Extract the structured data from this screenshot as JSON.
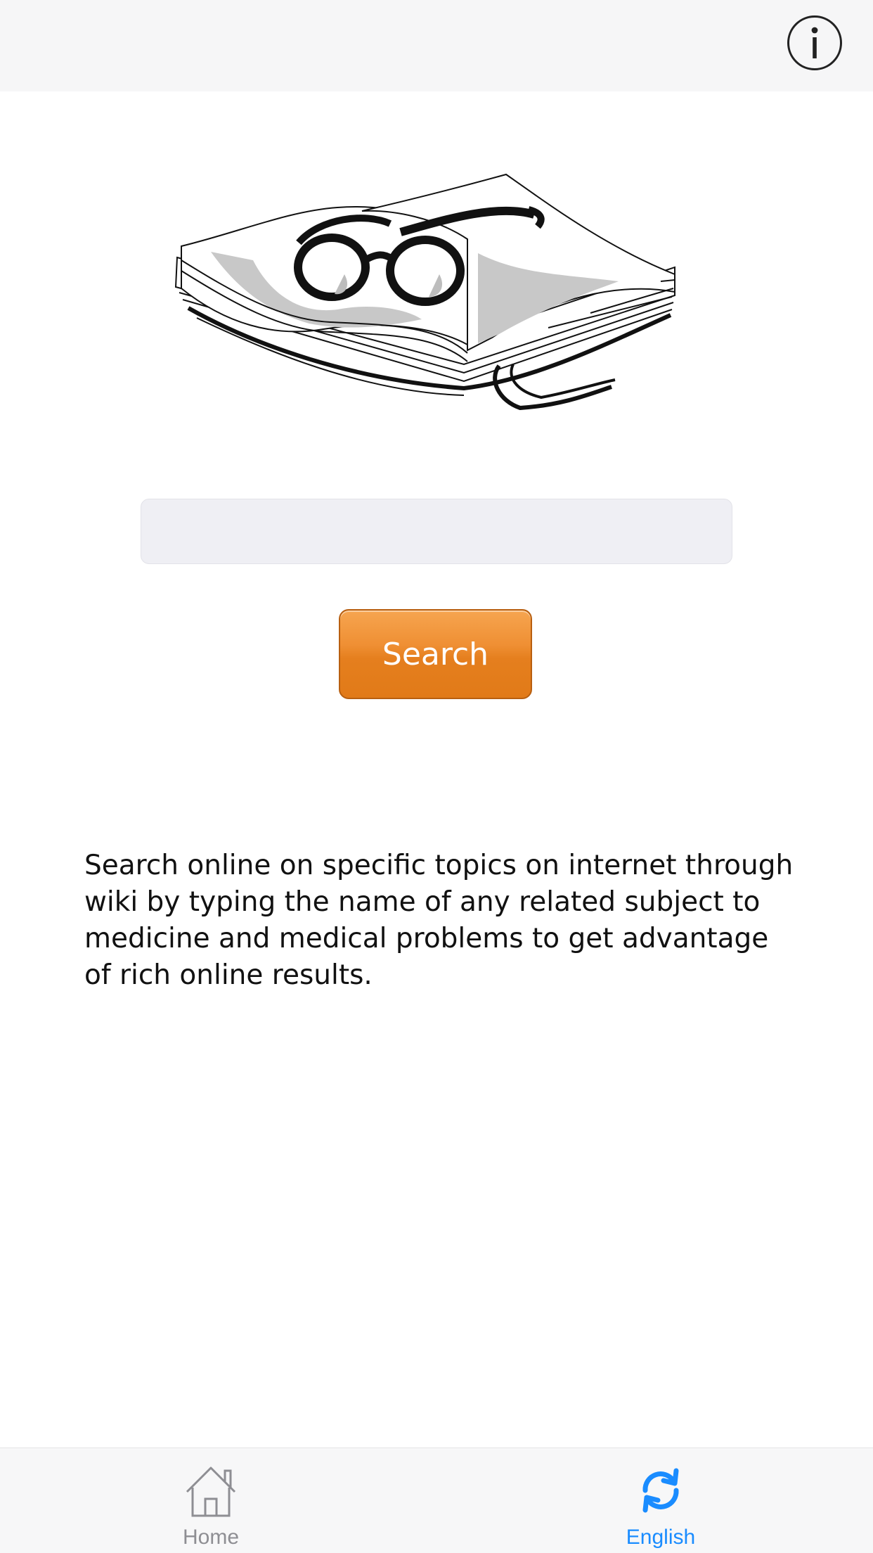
{
  "nav_bar": {
    "info_icon": "info-circle-icon"
  },
  "search": {
    "input_value": "",
    "input_placeholder": "",
    "button_label": "Search"
  },
  "description": "Search online on specific topics on internet through wiki by typing the name of any related subject to medicine and medical problems to get advantage of rich online results.",
  "tab_bar": {
    "items": [
      {
        "label": "Home",
        "icon": "home-icon",
        "selected": false
      },
      {
        "label": "English",
        "icon": "refresh-icon",
        "selected": true
      }
    ]
  },
  "colors": {
    "accent": "#1a8cff",
    "search_button": "#e57f1e",
    "inactive_tab": "#8e8e93"
  }
}
